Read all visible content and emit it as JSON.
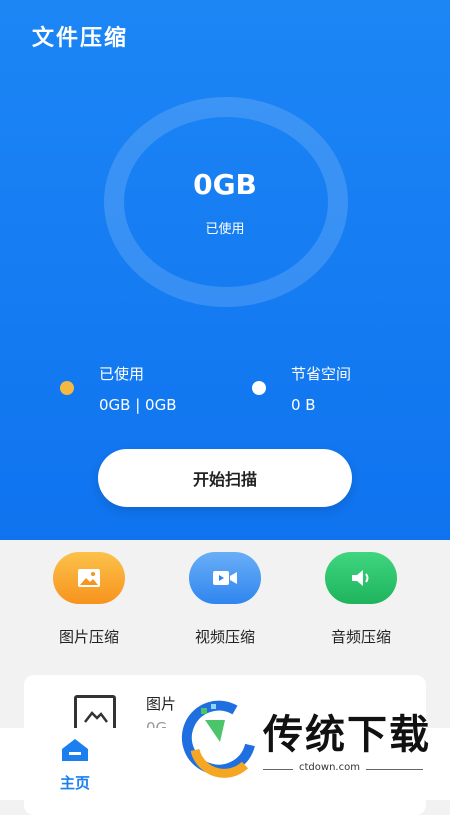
{
  "header": {
    "title": "文件压缩"
  },
  "storage_ring": {
    "value": "0GB",
    "label": "已使用"
  },
  "stats": {
    "used": {
      "label": "已使用",
      "value": "0GB | 0GB",
      "dot_color": "#f5b942"
    },
    "saved": {
      "label": "节省空间",
      "value": "0 B",
      "dot_color": "#ffffff"
    }
  },
  "scan_button": {
    "label": "开始扫描"
  },
  "tools": [
    {
      "label": "图片压缩",
      "icon": "image-icon",
      "color": "#f9a11b"
    },
    {
      "label": "视频压缩",
      "icon": "video-camera-icon",
      "color": "#3d8ff2"
    },
    {
      "label": "音频压缩",
      "icon": "speaker-icon",
      "color": "#22c26a"
    }
  ],
  "recent_card": {
    "title": "图片",
    "subtitle": "0G"
  },
  "bottom_nav": {
    "home_label": "主页"
  },
  "watermark": {
    "brand": "传统下载",
    "url": "ctdown.com"
  }
}
